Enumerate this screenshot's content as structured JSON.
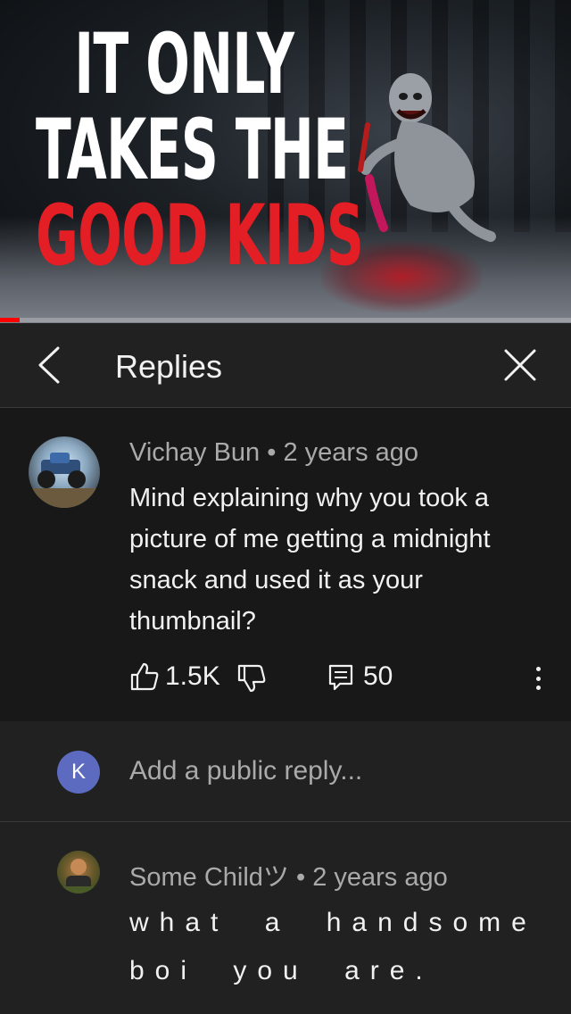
{
  "video": {
    "title_lines": [
      "IT ONLY",
      "TAKES THE",
      "GOOD KIDS"
    ],
    "progress_fraction": 0.035,
    "colors": {
      "title_white": "#ffffff",
      "title_red": "#e31e24",
      "progress": "#ff0000"
    }
  },
  "header": {
    "title": "Replies",
    "back_icon": "chevron-left-icon",
    "close_icon": "close-icon"
  },
  "parent_comment": {
    "author": "Vichay Bun",
    "separator": "•",
    "time": "2 years ago",
    "text": "Mind explaining why you took a picture of me getting a midnight snack and used it as your thumbnail?",
    "likes": "1.5K",
    "replies": "50",
    "icons": {
      "like": "thumbs-up-icon",
      "dislike": "thumbs-down-icon",
      "reply": "comment-icon",
      "more": "more-vertical-icon"
    }
  },
  "reply_box": {
    "user_initial": "K",
    "placeholder": "Add a public reply...",
    "avatar_color": "#5c6bc0"
  },
  "replies": [
    {
      "author": "Some Childツ",
      "separator": "•",
      "time": "2 years ago",
      "text": "what a handsome boi you are."
    }
  ],
  "theme": {
    "background": "#181818",
    "surface": "#212121",
    "text": "#f1f1f1",
    "secondary_text": "#aaaaaa"
  }
}
